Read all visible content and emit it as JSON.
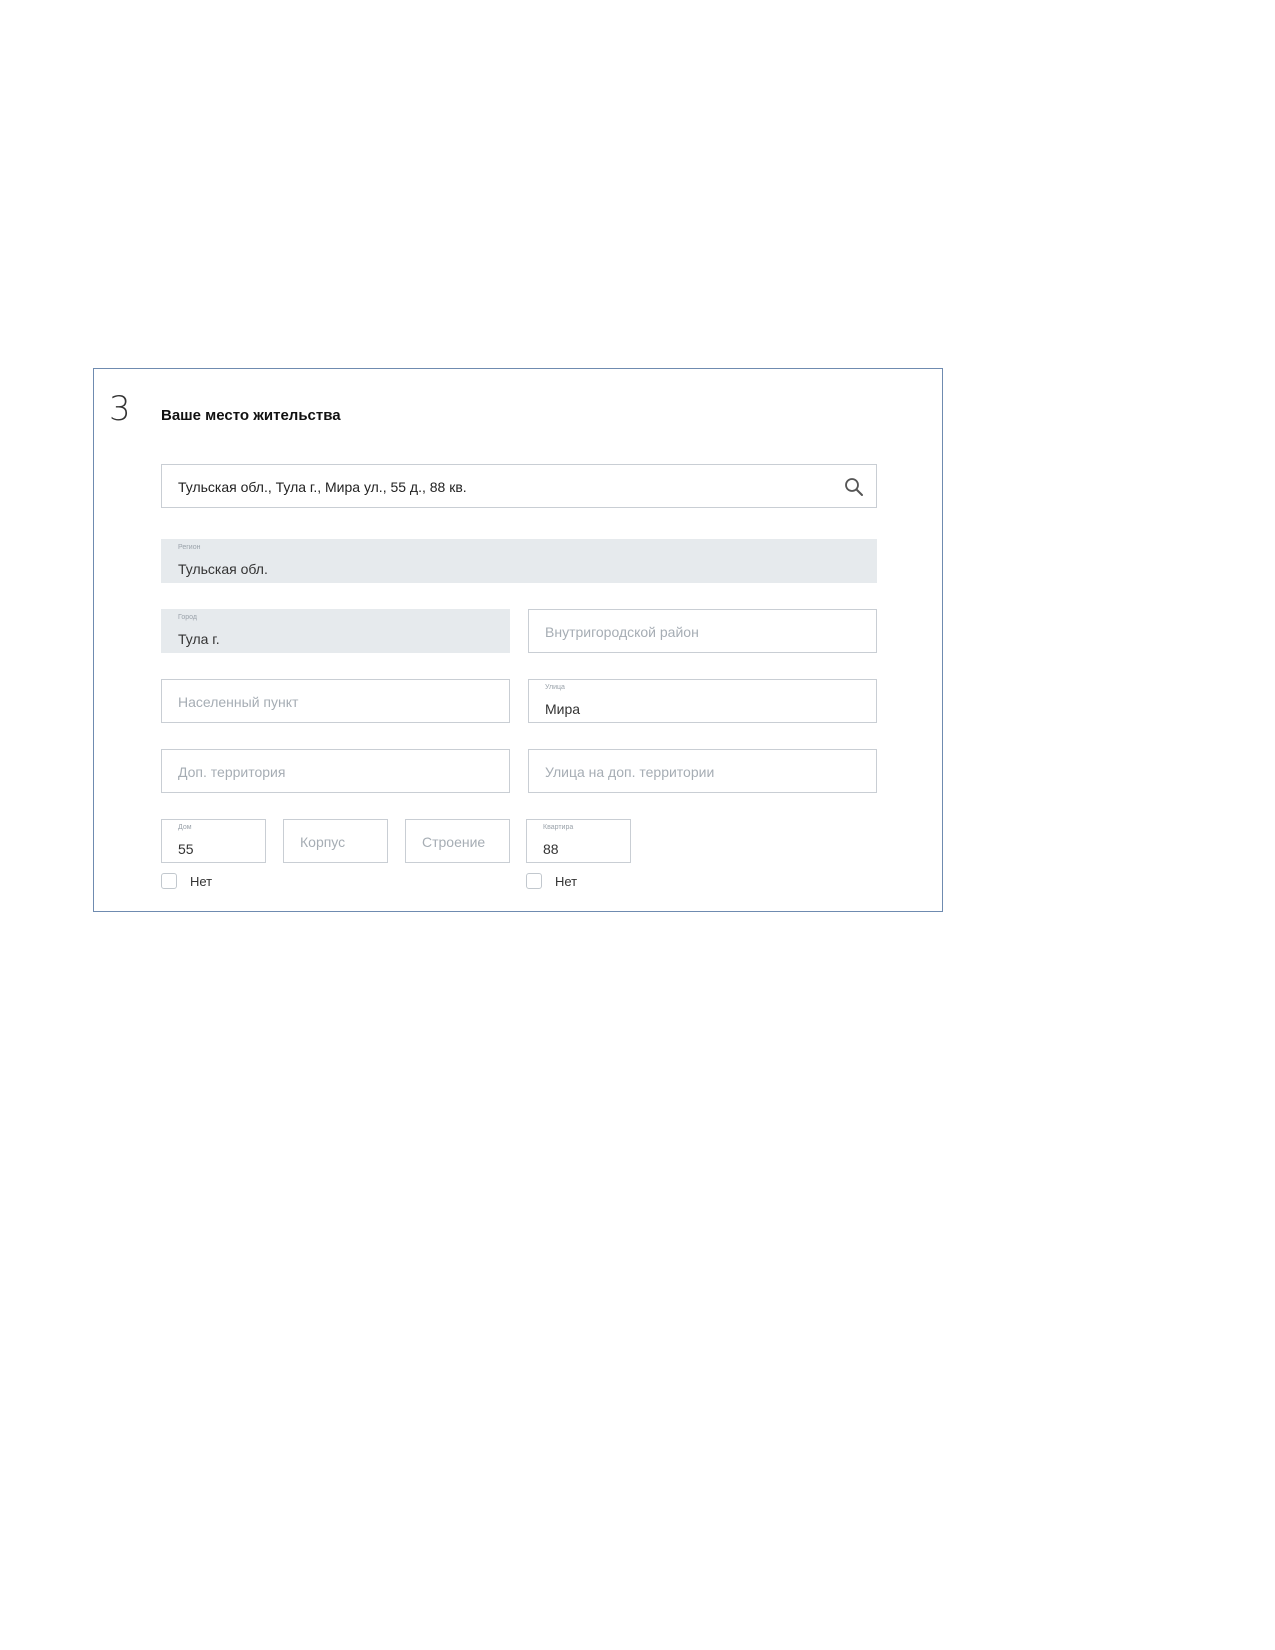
{
  "section": {
    "step_number": "3",
    "title": "Ваше место жительства"
  },
  "search": {
    "value": "Тульская обл., Тула г., Мира ул., 55 д., 88 кв.",
    "icon": "search-icon"
  },
  "fields": {
    "region": {
      "label": "Регион",
      "value": "Тульская обл."
    },
    "city": {
      "label": "Город",
      "value": "Тула г."
    },
    "district": {
      "placeholder": "Внутригородской район"
    },
    "locality": {
      "placeholder": "Населенный пункт"
    },
    "street": {
      "label": "Улица",
      "value": "Мира"
    },
    "extra_territory": {
      "placeholder": "Доп. территория"
    },
    "extra_territory_street": {
      "placeholder": "Улица на доп. территории"
    },
    "house": {
      "label": "Дом",
      "value": "55"
    },
    "building": {
      "placeholder": "Корпус"
    },
    "structure": {
      "placeholder": "Строение"
    },
    "apartment": {
      "label": "Квартира",
      "value": "88"
    }
  },
  "checkboxes": {
    "no_house": {
      "label": "Нет",
      "checked": false
    },
    "no_apartment": {
      "label": "Нет",
      "checked": false
    }
  },
  "colors": {
    "panel_border": "#6f8bb0",
    "field_border": "#c9ced4",
    "disabled_fill": "#e6eaed",
    "placeholder_text": "#a6adb4"
  }
}
